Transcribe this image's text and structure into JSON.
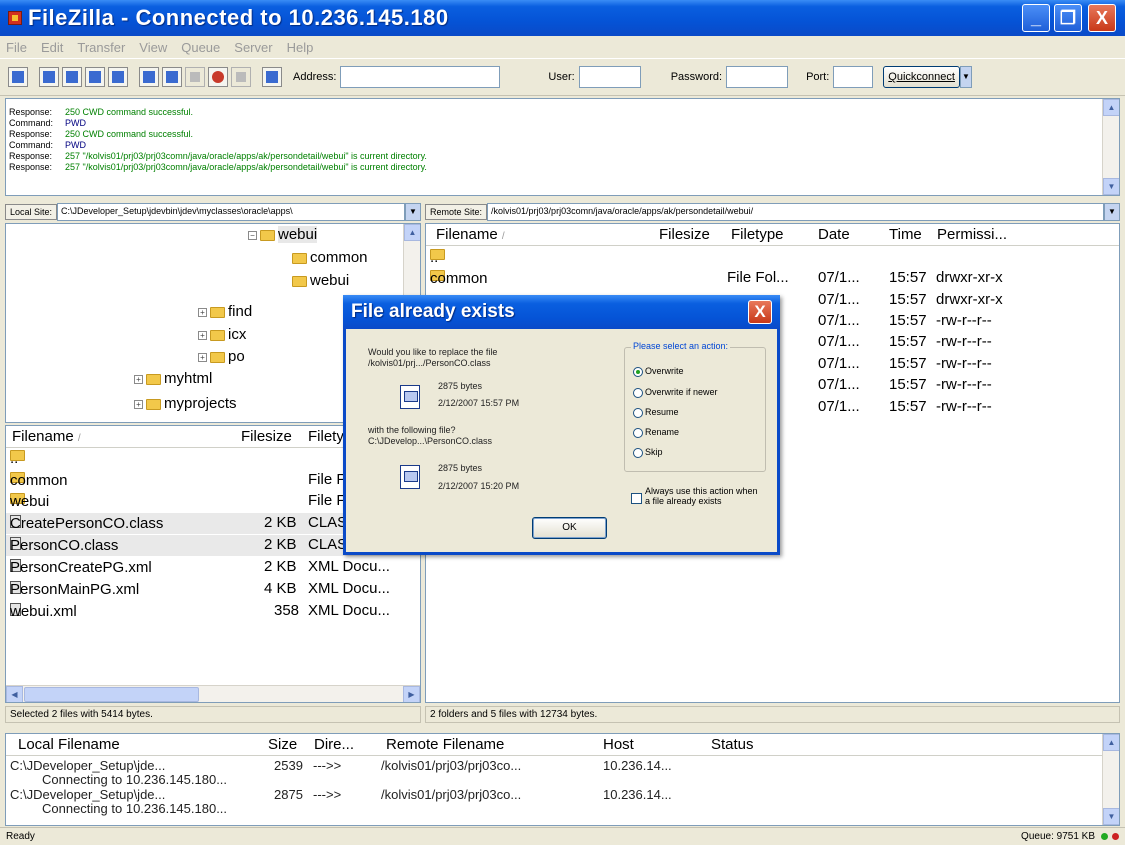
{
  "window": {
    "title": "FileZilla - Connected to 10.236.145.180",
    "min": "_",
    "max": "❐",
    "close": "X"
  },
  "menu": [
    "File",
    "Edit",
    "Transfer",
    "View",
    "Queue",
    "Server",
    "Help"
  ],
  "toolbar": {
    "address_label": "Address:",
    "user_label": "User:",
    "password_label": "Password:",
    "port_label": "Port:",
    "quickconnect_label": "Quickconnect",
    "address_value": "",
    "user_value": "",
    "password_value": "",
    "port_value": ""
  },
  "log": [
    {
      "kind": "Response:",
      "msg": "250 CWD command successful.",
      "type": "resp"
    },
    {
      "kind": "Command:",
      "msg": "PWD",
      "type": "cmd"
    },
    {
      "kind": "Response:",
      "msg": "250 CWD command successful.",
      "type": "resp"
    },
    {
      "kind": "Command:",
      "msg": "PWD",
      "type": "cmd"
    },
    {
      "kind": "Response:",
      "msg": "257 \"/kolvis01/prj03/prj03comn/java/oracle/apps/ak/persondetail/webui\" is current directory.",
      "type": "resp"
    },
    {
      "kind": "Response:",
      "msg": "257 \"/kolvis01/prj03/prj03comn/java/oracle/apps/ak/persondetail/webui\" is current directory.",
      "type": "resp"
    }
  ],
  "local_site": {
    "label": "Local Site:",
    "path": "C:\\JDeveloper_Setup\\jdevbin\\jdev\\myclasses\\oracle\\apps\\"
  },
  "remote_site": {
    "label": "Remote Site:",
    "path": "/kolvis01/prj03/prj03comn/java/oracle/apps/ak/persondetail/webui/"
  },
  "local_tree": {
    "nodes": [
      "webui",
      "common",
      "webui",
      "find",
      "icx",
      "po",
      "myhtml",
      "myprojects"
    ]
  },
  "local_list": {
    "headers": {
      "filename": "Filename",
      "filesize": "Filesize",
      "filetype": "Filety"
    },
    "sort_arrow": "/",
    "rows": [
      {
        "name": "..",
        "size": "",
        "type": ""
      },
      {
        "name": "common",
        "size": "",
        "type": "File F"
      },
      {
        "name": "webui",
        "size": "",
        "type": "File F"
      },
      {
        "name": "CreatePersonCO.class",
        "size": "2 KB",
        "type": "CLAS"
      },
      {
        "name": "PersonCO.class",
        "size": "2 KB",
        "type": "CLAS"
      },
      {
        "name": "PersonCreatePG.xml",
        "size": "2 KB",
        "type": "XML Docu..."
      },
      {
        "name": "PersonMainPG.xml",
        "size": "4 KB",
        "type": "XML Docu..."
      },
      {
        "name": "webui.xml",
        "size": "358",
        "type": "XML Docu..."
      }
    ],
    "status": "Selected 2 files with 5414 bytes."
  },
  "remote_list": {
    "headers": {
      "filename": "Filename",
      "filesize": "Filesize",
      "filetype": "Filetype",
      "date": "Date",
      "time": "Time",
      "perm": "Permissi..."
    },
    "sort_arrow": "/",
    "rows": [
      {
        "name": "..",
        "type": "",
        "date": "",
        "time": "",
        "perm": ""
      },
      {
        "name": "common",
        "type": "File Fol...",
        "date": "07/1...",
        "time": "15:57",
        "perm": "drwxr-xr-x"
      },
      {
        "name": "",
        "type": "",
        "date": "07/1...",
        "time": "15:57",
        "perm": "drwxr-xr-x"
      },
      {
        "name": "",
        "type": "",
        "date": "07/1...",
        "time": "15:57",
        "perm": "-rw-r--r--"
      },
      {
        "name": "",
        "type": "",
        "date": "07/1...",
        "time": "15:57",
        "perm": "-rw-r--r--"
      },
      {
        "name": "",
        "type": "",
        "date": "07/1...",
        "time": "15:57",
        "perm": "-rw-r--r--"
      },
      {
        "name": "",
        "type": "",
        "date": "07/1...",
        "time": "15:57",
        "perm": "-rw-r--r--"
      },
      {
        "name": "",
        "type": "",
        "date": "07/1...",
        "time": "15:57",
        "perm": "-rw-r--r--"
      }
    ],
    "status": "2 folders and 5 files with 12734 bytes."
  },
  "queue": {
    "headers": {
      "local": "Local Filename",
      "size": "Size",
      "dir": "Dire...",
      "remote": "Remote Filename",
      "host": "Host",
      "status": "Status"
    },
    "rows": [
      {
        "local": "C:\\JDeveloper_Setup\\jde...",
        "size": "2539",
        "dir": "--->>",
        "remote": "/kolvis01/prj03/prj03co...",
        "host": "10.236.14..."
      },
      {
        "local": "Connecting to 10.236.145.180...",
        "size": "",
        "dir": "",
        "remote": "",
        "host": ""
      },
      {
        "local": "C:\\JDeveloper_Setup\\jde...",
        "size": "2875",
        "dir": "--->>",
        "remote": "/kolvis01/prj03/prj03co...",
        "host": "10.236.14..."
      },
      {
        "local": "Connecting to 10.236.145.180...",
        "size": "",
        "dir": "",
        "remote": "",
        "host": ""
      }
    ]
  },
  "statusbar": {
    "ready": "Ready",
    "queue": "Queue: 9751 KB"
  },
  "dialog": {
    "title": "File already exists",
    "close": "X",
    "question": "Would you like to replace the file",
    "target_path": "/kolvis01/prj.../PersonCO.class",
    "target_size": "2875 bytes",
    "target_date": "2/12/2007 15:57 PM",
    "with_label": "with the following file?",
    "source_path": "C:\\JDevelop...\\PersonCO.class",
    "source_size": "2875 bytes",
    "source_date": "2/12/2007 15:20 PM",
    "group_title": "Please select an action:",
    "options": [
      "Overwrite",
      "Overwrite if newer",
      "Resume",
      "Rename",
      "Skip"
    ],
    "selected_option": "Overwrite",
    "always_label": "Always use this action when a file already exists",
    "ok_label": "OK"
  },
  "colors": {
    "title_blue": "#0553d6",
    "close_red": "#c83818",
    "log_response": "#008000",
    "log_command": "#000080"
  }
}
